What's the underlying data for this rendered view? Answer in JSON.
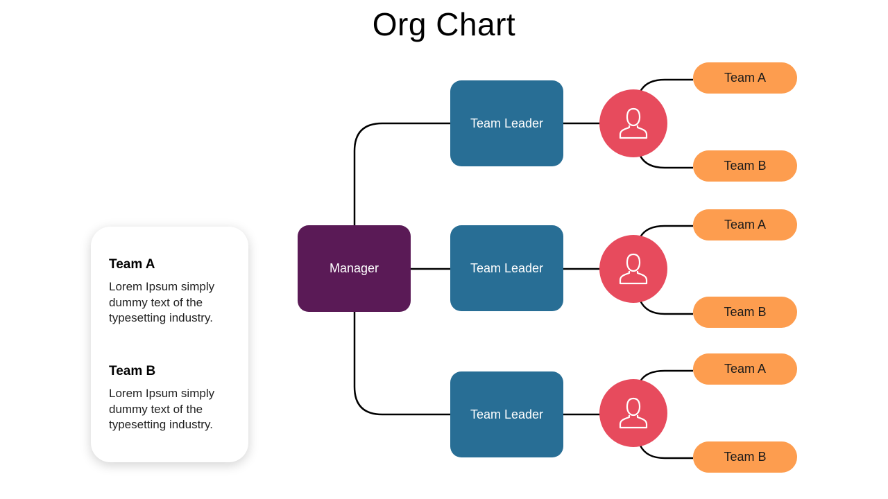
{
  "title": "Org Chart",
  "colors": {
    "manager": "#5a1a56",
    "team_leader": "#286e95",
    "person_circle": "#e74b5d",
    "team_pill": "#fd9d4f",
    "connector": "#000000"
  },
  "manager": {
    "label": "Manager"
  },
  "branches": [
    {
      "leader_label": "Team Leader",
      "icon": "user-icon",
      "teams": [
        "Team A",
        "Team B"
      ]
    },
    {
      "leader_label": "Team Leader",
      "icon": "user-icon",
      "teams": [
        "Team A",
        "Team B"
      ]
    },
    {
      "leader_label": "Team Leader",
      "icon": "user-icon",
      "teams": [
        "Team A",
        "Team B"
      ]
    }
  ],
  "legend": {
    "items": [
      {
        "heading": "Team A",
        "text": "Lorem Ipsum simply dummy text of the typesetting industry."
      },
      {
        "heading": "Team B",
        "text": "Lorem Ipsum simply dummy text of the typesetting industry."
      }
    ]
  }
}
